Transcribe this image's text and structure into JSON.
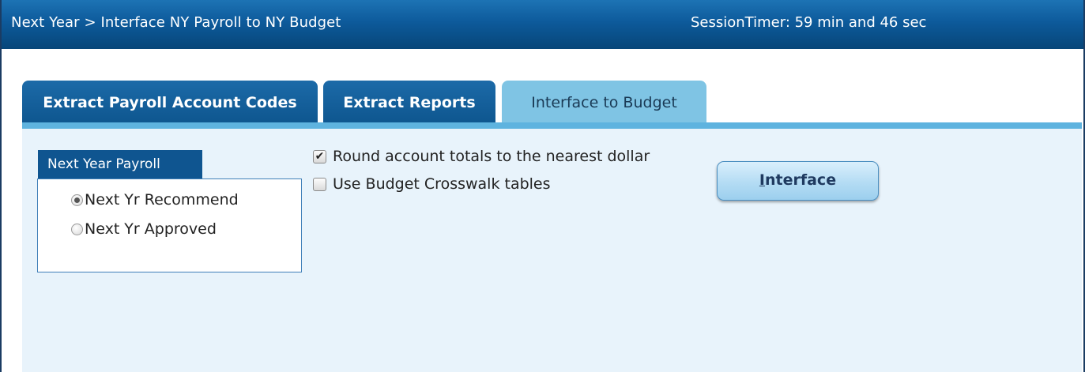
{
  "window": {
    "breadcrumb": "Next Year > Interface NY Payroll to NY Budget",
    "session_timer": "SessionTimer: 59 min and 46 sec"
  },
  "tabs": [
    {
      "label": "Extract Payroll Account Codes",
      "active": false
    },
    {
      "label": "Extract Reports",
      "active": false
    },
    {
      "label": "Interface to Budget",
      "active": true
    }
  ],
  "payroll_group": {
    "title": "Next Year Payroll",
    "options": [
      {
        "label": "Next Yr Recommend",
        "selected": true
      },
      {
        "label": "Next Yr Approved",
        "selected": false
      }
    ]
  },
  "options": {
    "round_totals": {
      "label": "Round account totals to the nearest dollar",
      "checked": true
    },
    "crosswalk": {
      "label": "Use Budget Crosswalk tables",
      "checked": false
    }
  },
  "interface_button": {
    "mnemonic": "I",
    "rest": "nterface"
  },
  "colors": {
    "titlebar": "#0d5a9b",
    "tab_inactive": "#0e568f",
    "tab_active": "#7fc4e4",
    "content_bg": "#e8f3fb"
  }
}
